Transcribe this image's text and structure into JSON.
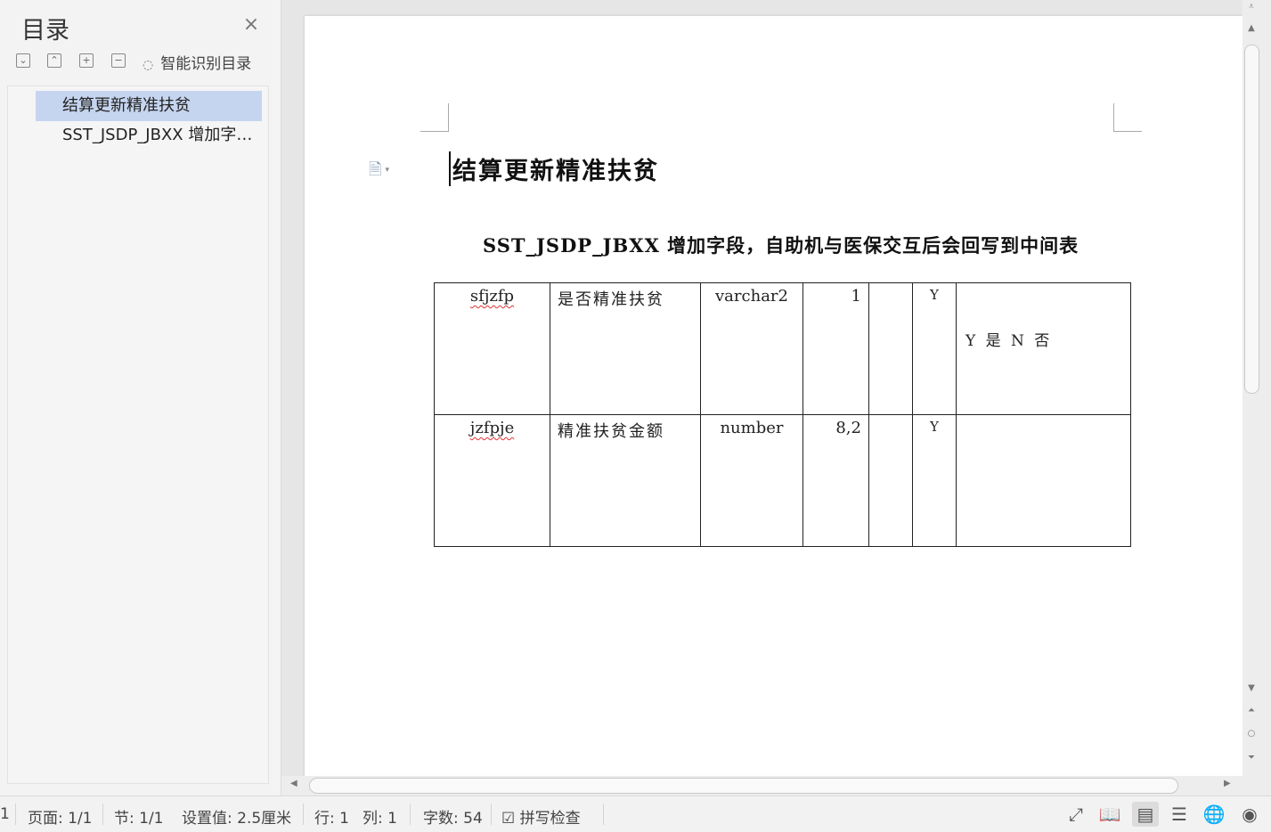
{
  "toc": {
    "title": "目录",
    "close_icon": "×",
    "tools": [
      {
        "name": "collapse-all-icon",
        "glyph": "⌄"
      },
      {
        "name": "expand-up-icon",
        "glyph": "⌃"
      },
      {
        "name": "add-level-icon",
        "glyph": "+"
      },
      {
        "name": "remove-level-icon",
        "glyph": "−"
      }
    ],
    "smart_label": "智能识别目录",
    "items": [
      {
        "label": "结算更新精准扶贫",
        "active": true
      },
      {
        "label": "SST_JSDP_JBXX 增加字段，自助机与医保交互后会回写到中间表",
        "active": false
      }
    ]
  },
  "document": {
    "heading1": "结算更新精准扶贫",
    "heading2": "SST_JSDP_JBXX 增加字段，自助机与医保交互后会回写到中间表",
    "table": {
      "rows": [
        {
          "field": "sfjzfp",
          "comment": "是否精准扶贫",
          "type": "varchar2",
          "length": "1",
          "key": "",
          "nullable": "Y",
          "desc": "Y 是 N 否"
        },
        {
          "field": "jzfpje",
          "comment": "精准扶贫金额",
          "type": "number",
          "length": "8,2",
          "key": "",
          "nullable": "Y",
          "desc": ""
        }
      ]
    }
  },
  "statusbar": {
    "page_num": "1",
    "page": "页面: 1/1",
    "section": "节: 1/1",
    "setting": "设置值: 2.5厘米",
    "row": "行: 1",
    "col": "列: 1",
    "word_count": "字数: 54",
    "spell_check": "拼写检查"
  },
  "colors": {
    "toc_active": "#c6d5ef",
    "spell_error": "#dd3333"
  }
}
